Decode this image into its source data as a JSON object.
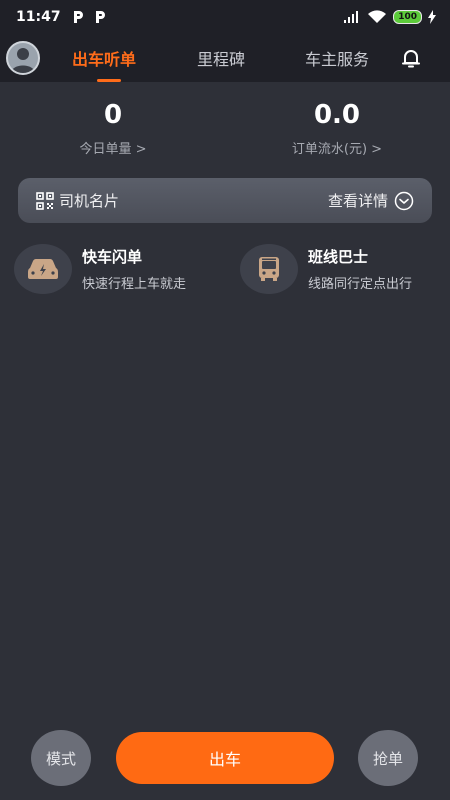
{
  "status_bar": {
    "time": "11:47",
    "battery": "100"
  },
  "nav": {
    "tabs": [
      {
        "label": "出车听单",
        "active": true
      },
      {
        "label": "里程碑",
        "active": false
      },
      {
        "label": "车主服务",
        "active": false
      }
    ]
  },
  "stats": {
    "orders_today": {
      "value": "0",
      "label": "今日单量 >"
    },
    "order_revenue": {
      "value": "0.0",
      "label": "订单流水(元) >"
    }
  },
  "name_card": {
    "title": "司机名片",
    "action": "查看详情"
  },
  "services": [
    {
      "title": "快车闪单",
      "subtitle": "快速行程上车就走",
      "icon": "car-icon"
    },
    {
      "title": "班线巴士",
      "subtitle": "线路同行定点出行",
      "icon": "bus-icon"
    }
  ],
  "bottom_bar": {
    "mode_label": "模式",
    "go_label": "出车",
    "grab_label": "抢单"
  },
  "colors": {
    "accent": "#ff6a13",
    "background": "#2e3038",
    "header": "#1f2027"
  }
}
